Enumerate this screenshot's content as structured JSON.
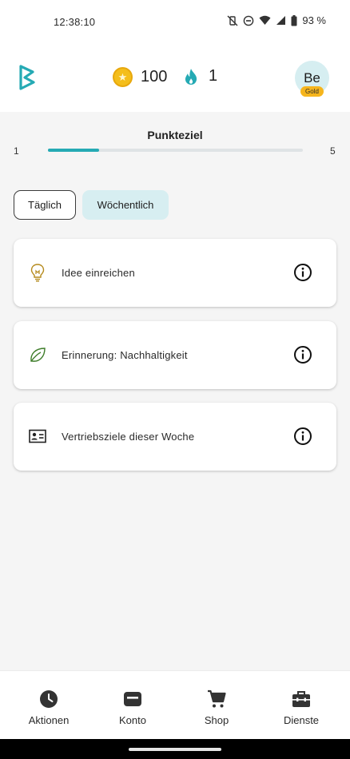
{
  "status_bar": {
    "time": "12:38:10",
    "battery": "93 %",
    "icons": [
      "vibrate-off-icon",
      "dnd-icon",
      "wifi-icon",
      "signal-icon",
      "battery-icon"
    ]
  },
  "header": {
    "logo": "b-logo-icon",
    "coins": "100",
    "coin_icon": "coin-star-icon",
    "streak": "1",
    "streak_icon": "flame-icon",
    "avatar_initials": "Be",
    "level_badge": "Gold",
    "colors": {
      "accent": "#25aab4",
      "coin": "#f4be1b",
      "badge": "#f6b51c",
      "avatar_bg": "#d6eef1"
    }
  },
  "goal": {
    "title": "Punkteziel",
    "min": "1",
    "max": "5",
    "progress_fraction": 0.2
  },
  "tabs": [
    {
      "label": "Täglich",
      "selected": false
    },
    {
      "label": "Wöchentlich",
      "selected": true
    }
  ],
  "actions": [
    {
      "label": "Idee einreichen",
      "icon": "lightbulb-icon",
      "icon_color": "#b58a1c"
    },
    {
      "label": "Erinnerung: Nachhaltigkeit",
      "icon": "leaf-icon",
      "icon_color": "#3e7d2a"
    },
    {
      "label": "Vertriebsziele dieser Woche",
      "icon": "id-card-icon",
      "icon_color": "#222222"
    }
  ],
  "bottom_nav": [
    {
      "label": "Aktionen",
      "icon": "clock-icon"
    },
    {
      "label": "Konto",
      "icon": "wallet-icon"
    },
    {
      "label": "Shop",
      "icon": "cart-icon"
    },
    {
      "label": "Dienste",
      "icon": "toolbox-icon"
    }
  ]
}
